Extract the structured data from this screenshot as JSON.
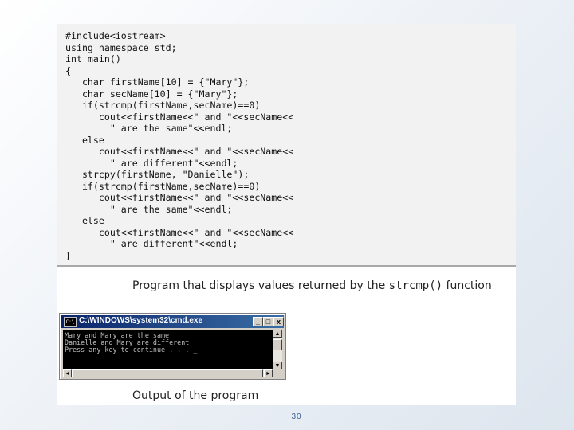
{
  "code_lines": [
    "#include<iostream>",
    "using namespace std;",
    "int main()",
    "{",
    "   char firstName[10] = {\"Mary\"};",
    "   char secName[10] = {\"Mary\"};",
    "   if(strcmp(firstName,secName)==0)",
    "      cout<<firstName<<\" and \"<<secName<<",
    "        \" are the same\"<<endl;",
    "   else",
    "      cout<<firstName<<\" and \"<<secName<<",
    "        \" are different\"<<endl;",
    "   strcpy(firstName, \"Danielle\");",
    "   if(strcmp(firstName,secName)==0)",
    "      cout<<firstName<<\" and \"<<secName<<",
    "        \" are the same\"<<endl;",
    "   else",
    "      cout<<firstName<<\" and \"<<secName<<",
    "        \" are different\"<<endl;",
    "}"
  ],
  "caption_program": {
    "text_before": "Program that displays values returned by the ",
    "code": "strcmp()",
    "text_after": " function"
  },
  "cmd_window": {
    "title": "C:\\WINDOWS\\system32\\cmd.exe",
    "icon_label": "C:\\",
    "min_label": "_",
    "max_label": "□",
    "close_label": "x",
    "output_lines": [
      "Mary and Mary are the same",
      "Danielle and Mary are different",
      "Press any key to continue . . . _"
    ],
    "scroll_up": "▲",
    "scroll_down": "▼",
    "scroll_left": "◄",
    "scroll_right": "►"
  },
  "caption_output": "Output of the program",
  "page_number": "30"
}
